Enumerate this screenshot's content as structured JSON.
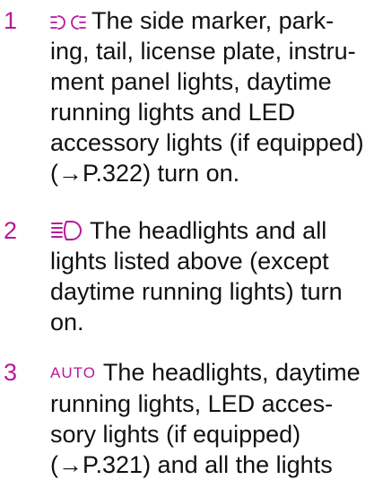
{
  "colors": {
    "accent": "#b8189a",
    "text": "#111111"
  },
  "items": [
    {
      "number": "1",
      "icon": "parking-lights-icon",
      "lines": [
        "The side marker, park-",
        "ing, tail, license plate, instru-",
        "ment panel lights, daytime",
        "running lights and LED",
        "accessory lights (if equipped)",
        "(→P.322) turn on."
      ]
    },
    {
      "number": "2",
      "icon": "headlight-icon",
      "lines": [
        "The headlights and all",
        "lights listed above (except",
        "daytime running lights) turn",
        "on."
      ]
    },
    {
      "number": "3",
      "icon_text": "AUTO",
      "lines": [
        "The headlights, daytime",
        "running lights, LED acces-",
        "sory lights (if equipped)",
        "(→P.321) and all the lights"
      ]
    }
  ]
}
